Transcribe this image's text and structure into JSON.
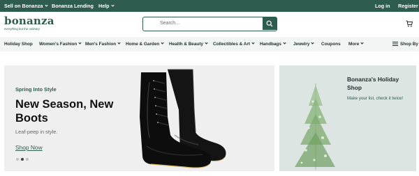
{
  "topbar": {
    "sell": "Sell on Bonanza",
    "lending": "Bonanza Lending",
    "help": "Help",
    "login": "Log in",
    "register": "Register"
  },
  "header": {
    "logo_text": "bonanza",
    "tagline": "everything but the ordinary",
    "search_placeholder": "Search..."
  },
  "nav": {
    "items": [
      "Holiday Shop",
      "Women's Fashion",
      "Men's Fashion",
      "Home & Garden",
      "Health & Beauty",
      "Collectibles & Art",
      "Handbags",
      "Jewelry",
      "Coupons",
      "More"
    ],
    "shop_by": "Shop By"
  },
  "hero": {
    "eyebrow": "Spring Into Style",
    "title": "New Season, New Boots",
    "subtitle": "Leaf-peep in style.",
    "cta": "Shop Now",
    "slide_count": 3,
    "active_slide": 2
  },
  "promo": {
    "title": "Bonanza's Holiday Shop",
    "subtitle": "Make your list, check it twice!"
  },
  "colors": {
    "brand_green": "#2e5c4f",
    "nav_bg": "#f1f5f3",
    "hero_bg": "#efefef",
    "promo_bg": "#dde5e3"
  },
  "icons": [
    "chevron-down-icon",
    "search-icon",
    "cart-icon",
    "menu-icon"
  ]
}
